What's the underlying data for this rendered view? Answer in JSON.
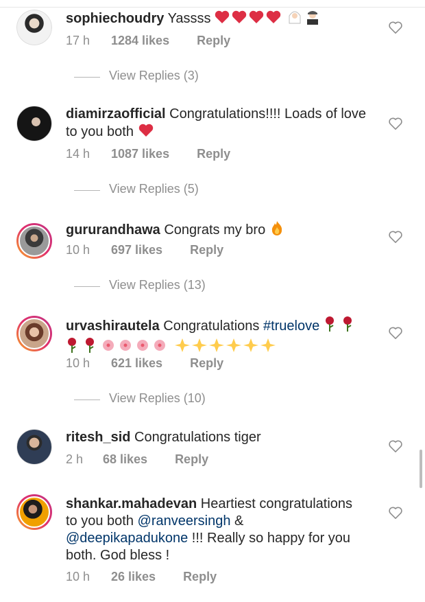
{
  "comments": [
    {
      "username": "sophiechoudry",
      "text": "Yassss",
      "time": "17 h",
      "likes": "1284 likes",
      "reply": "Reply",
      "emoji": [
        "heart",
        "heart",
        "heart",
        "heart",
        "bride",
        "groom"
      ],
      "view_replies": "View Replies (3)"
    },
    {
      "username": "diamirzaofficial",
      "text": "Congratulations!!!! Loads of love to you both",
      "time": "14 h",
      "likes": "1087 likes",
      "reply": "Reply",
      "emoji": [
        "heart"
      ],
      "view_replies": "View Replies (5)"
    },
    {
      "username": "gururandhawa",
      "text": "Congrats my bro",
      "time": "10 h",
      "likes": "697 likes",
      "reply": "Reply",
      "emoji": [
        "fire"
      ],
      "view_replies": "View Replies (13)"
    },
    {
      "username": "urvashirautela",
      "text": "Congratulations",
      "hashtag": "#truelove",
      "time": "10 h",
      "likes": "621 likes",
      "reply": "Reply",
      "emoji": [
        "rose",
        "rose",
        "rose",
        "rose",
        "blossom",
        "blossom",
        "blossom",
        "blossom",
        "sparkles",
        "sparkles",
        "sparkles",
        "sparkles",
        "sparkles",
        "sparkles"
      ],
      "view_replies": "View Replies (10)"
    },
    {
      "username": "ritesh_sid",
      "text": "Congratulations tiger",
      "time": "2 h",
      "likes": "68 likes",
      "reply": "Reply"
    },
    {
      "username": "shankar.mahadevan",
      "text_1": "Heartiest congratulations to you both",
      "mention_1": "@ranveersingh",
      "text_2": "&",
      "mention_2": "@deepikapadukone",
      "text_3": "!!! Really so happy for you both. God bless !",
      "time": "10 h",
      "likes": "26 likes",
      "reply": "Reply"
    }
  ],
  "colors": {
    "text": "#262626",
    "meta": "#8e8e8e",
    "link": "#003569",
    "heart_emoji": "#dd2e44"
  },
  "icons": [
    "like-heart-outline-icon",
    "avatar"
  ]
}
